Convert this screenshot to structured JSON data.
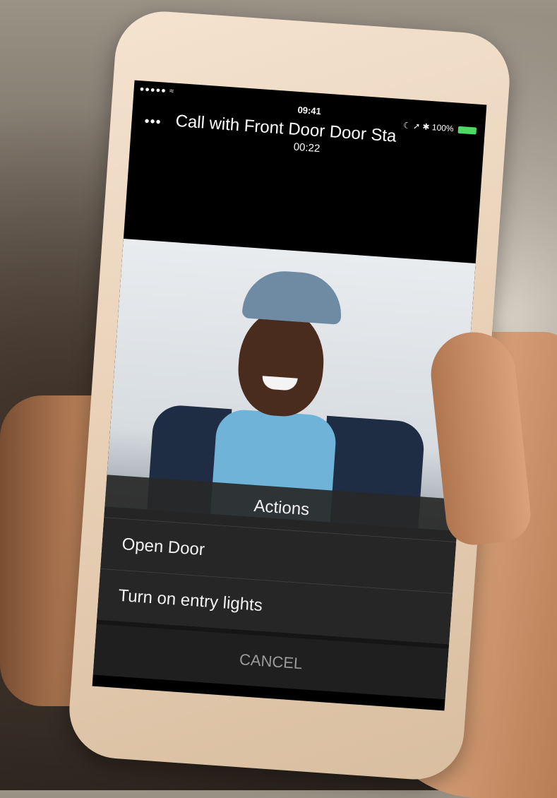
{
  "status_bar": {
    "signal": "●●●●● ≈",
    "time": "09:41",
    "icons": "☾ ➚ ✱",
    "battery": "100%"
  },
  "call": {
    "more": "•••",
    "title": "Call with Front Door Door Sta",
    "timer": "00:22"
  },
  "actions": {
    "title": "Actions",
    "items": [
      "Open Door",
      "Turn on entry lights"
    ],
    "cancel": "CANCEL"
  }
}
